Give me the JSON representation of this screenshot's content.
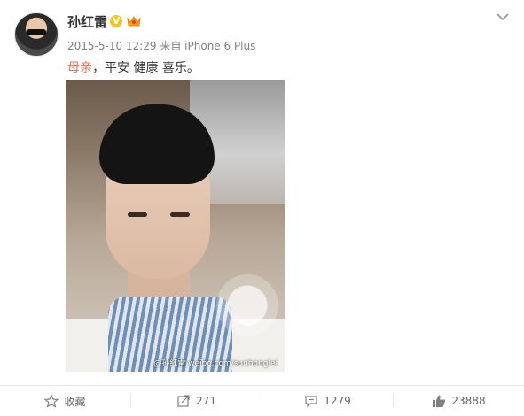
{
  "post": {
    "author": "孙红雷",
    "timestamp": "2015-5-10 12:29",
    "source_prefix": "来自",
    "source": "iPhone 6 Plus",
    "mention": "母亲",
    "text": "，平安  健康  喜乐。",
    "verified_badge": "V",
    "image_watermark": "@孙红雷 weibo.com/sunhonglei"
  },
  "actions": {
    "favorite": "收藏",
    "repost": "271",
    "comment": "1279",
    "like": "23888"
  },
  "icons": {
    "more": "chevron-down-icon",
    "favorite": "star-icon",
    "repost": "repost-icon",
    "comment": "comment-icon",
    "like": "thumbs-up-icon"
  },
  "colors": {
    "mention": "#eb7350",
    "meta": "#808080",
    "verified": "#f6c416"
  }
}
